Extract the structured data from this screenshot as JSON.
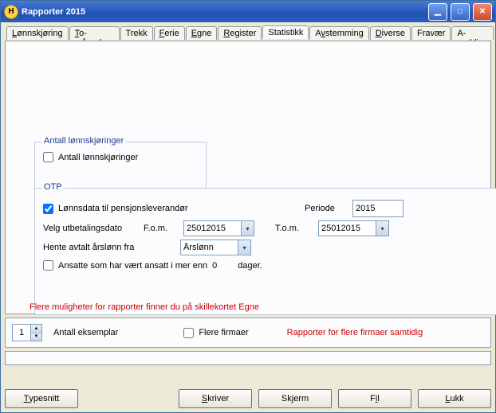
{
  "window": {
    "title": "Rapporter 2015"
  },
  "tabs": [
    {
      "label": "Lønnskjøring",
      "mnidx": 0
    },
    {
      "label": "To-måneders",
      "mnidx": 0
    },
    {
      "label": "Trekk",
      "mnidx": -1
    },
    {
      "label": "Ferie",
      "mnidx": 0
    },
    {
      "label": "Egne",
      "mnidx": 0
    },
    {
      "label": "Register",
      "mnidx": 0
    },
    {
      "label": "Statistikk",
      "mnidx": -1,
      "active": true
    },
    {
      "label": "Avstemming",
      "mnidx": 1
    },
    {
      "label": "Diverse",
      "mnidx": 0
    },
    {
      "label": "Fravær",
      "mnidx": -1
    },
    {
      "label": "A-melding",
      "mnidx": -1
    }
  ],
  "group_al": {
    "legend": "Antall lønnskjøringer",
    "checkbox_label": "Antall lønnskjøringer",
    "checked": false
  },
  "group_otp": {
    "legend": "OTP",
    "cb_lonnsdata_label": "Lønnsdata til pensjonsleverandør",
    "cb_lonnsdata_checked": true,
    "periode_label": "Periode",
    "periode_value": "2015",
    "velg_label": "Velg utbetalingsdato",
    "fom_label": "F.o.m.",
    "fom_value": "25012015",
    "tom_label": "T.o.m.",
    "tom_value": "25012015",
    "hente_label": "Hente avtalt årslønn fra",
    "hente_value": "Årslønn",
    "cb_ansatte_checked": false,
    "ansatte_prefix": "Ansatte som har vært ansatt i mer enn",
    "ansatte_value": "0",
    "ansatte_suffix": "dager."
  },
  "hint": "Flere muligheter for rapporter finner du på skillekortet Egne",
  "lower": {
    "antall_value": "1",
    "antall_label": "Antall eksemplar",
    "multi_checked": false,
    "multi_label": "Flere firmaer",
    "red": "Rapporter for flere firmaer samtidig"
  },
  "buttons": {
    "typesnitt": "Typesnitt",
    "skriver": "Skriver",
    "skjerm": "Skjerm",
    "fil": "Fil",
    "lukk": "Lukk"
  }
}
